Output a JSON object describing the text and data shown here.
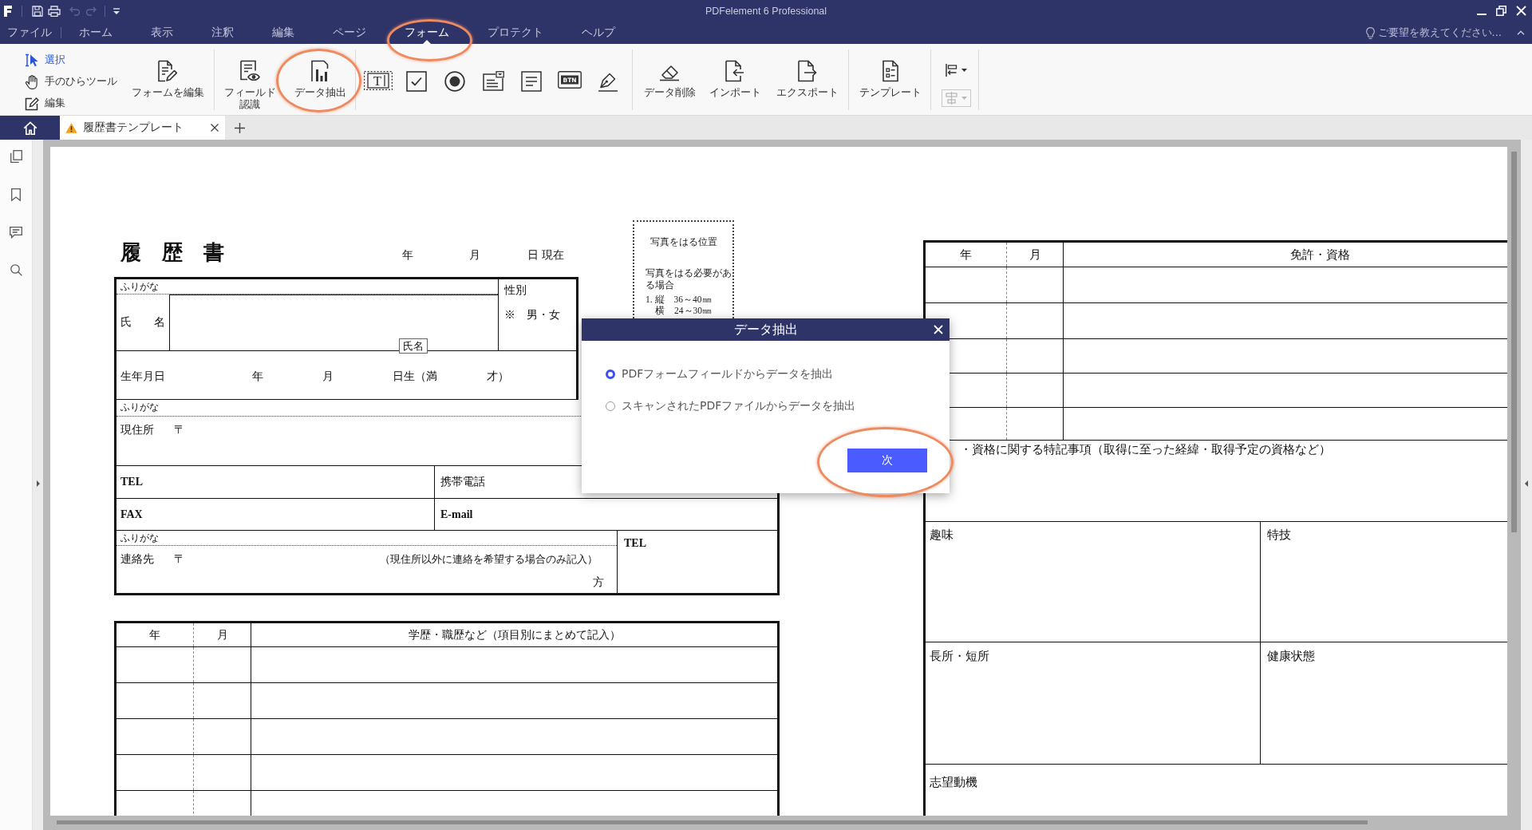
{
  "window": {
    "title": "PDFelement 6 Professional"
  },
  "quick_access": [
    {
      "kind": "save",
      "disabled": false
    },
    {
      "kind": "print",
      "disabled": false
    },
    {
      "kind": "undo",
      "disabled": true
    },
    {
      "kind": "redo",
      "disabled": true
    },
    {
      "kind": "customize",
      "disabled": false
    }
  ],
  "menu": [
    {
      "label": "ファイル",
      "selected": false,
      "highlighted": false
    },
    {
      "label": "ホーム",
      "selected": false,
      "highlighted": false
    },
    {
      "label": "表示",
      "selected": false,
      "highlighted": false
    },
    {
      "label": "注釈",
      "selected": false,
      "highlighted": false
    },
    {
      "label": "編集",
      "selected": false,
      "highlighted": false
    },
    {
      "label": "ページ",
      "selected": false,
      "highlighted": false
    },
    {
      "label": "フォーム",
      "selected": true,
      "highlighted": true
    },
    {
      "label": "プロテクト",
      "selected": false,
      "highlighted": false
    },
    {
      "label": "ヘルプ",
      "selected": false,
      "highlighted": false
    }
  ],
  "help_prompt": "ご要望を教えてください...",
  "tools": [
    {
      "kind": "select",
      "label": "選択",
      "selected": true
    },
    {
      "kind": "hand",
      "label": "手のひらツール",
      "selected": false
    },
    {
      "kind": "edit",
      "label": "編集",
      "selected": false
    }
  ],
  "ribbon": [
    {
      "items": [
        {
          "kind": "edit_form",
          "label": "フォームを編集",
          "highlighted": false,
          "disabled": false
        }
      ]
    },
    {
      "items": [
        {
          "kind": "field_recognition",
          "label": "フィールド認識",
          "highlighted": false,
          "disabled": false
        },
        {
          "kind": "data_extract",
          "label": "データ抽出",
          "highlighted": true,
          "disabled": false
        }
      ]
    },
    {
      "items": [
        {
          "kind": "text_field",
          "glyph": "T",
          "highlighted": false,
          "disabled": false
        },
        {
          "kind": "checkbox",
          "highlighted": false,
          "disabled": false
        },
        {
          "kind": "radio_button",
          "highlighted": false,
          "disabled": false
        },
        {
          "kind": "combo_box",
          "highlighted": false,
          "disabled": false
        },
        {
          "kind": "list_box",
          "highlighted": false,
          "disabled": false
        },
        {
          "kind": "button_field",
          "glyph": "BTN",
          "highlighted": false,
          "disabled": false
        },
        {
          "kind": "signature",
          "highlighted": false,
          "disabled": false
        }
      ]
    },
    {
      "items": [
        {
          "kind": "data_delete",
          "label": "データ削除",
          "highlighted": false,
          "disabled": false
        },
        {
          "kind": "import",
          "label": "インポート",
          "highlighted": false,
          "disabled": false
        },
        {
          "kind": "export",
          "label": "エクスポート",
          "highlighted": false,
          "disabled": false
        }
      ]
    },
    {
      "items": [
        {
          "kind": "template",
          "label": "テンプレート",
          "highlighted": false,
          "disabled": false
        }
      ]
    },
    {
      "items": [
        {
          "kind": "align",
          "highlighted": false,
          "disabled": false
        },
        {
          "kind": "distribute",
          "highlighted": false,
          "disabled": true
        }
      ]
    }
  ],
  "document_tabs": [
    {
      "label": "履歴書テンプレート",
      "selected": true,
      "warning": true
    }
  ],
  "resume": {
    "title": "履　歴　書",
    "date_labels": [
      "年",
      "月",
      "日 現在"
    ],
    "name": {
      "furigana": "ふりがな",
      "label": "氏　　名",
      "field_tag": "氏名"
    },
    "gender": {
      "label": "性別",
      "options": "※　男・女"
    },
    "birth_date": {
      "label": "生年月日",
      "parts": [
        "年",
        "月",
        "日生（満",
        "才）"
      ]
    },
    "address": {
      "furigana": "ふりがな",
      "label": "現住所",
      "postal_mark": "〒"
    },
    "phone": {
      "home": "TEL",
      "mobile": "携帯電話"
    },
    "fax": {
      "fax": "FAX",
      "email": "E-mail"
    },
    "contact": {
      "furigana": "ふりがな",
      "label": "連絡先",
      "postal_mark": "〒",
      "note": "（現住所以外に連絡を希望する場合のみ記入）",
      "suffix": "方",
      "tel": "TEL"
    },
    "photo": {
      "title": "写真をはる位置",
      "note": "写真をはる必要がある場合",
      "sizes": [
        "1. 縦　36～40㎜",
        "横　24～30㎜"
      ]
    },
    "education": {
      "columns": [
        "年",
        "月",
        "学歴・職歴など（項目別にまとめて記入）"
      ]
    },
    "licenses": {
      "columns": [
        "年",
        "月",
        "免許・資格"
      ]
    },
    "license_notes": "・資格に関する特記事項（取得に至った経緯・取得予定の資格など）",
    "hobbies": "趣味",
    "skills": "特技",
    "strengths": "長所・短所",
    "health": "健康状態",
    "motivation": "志望動機"
  },
  "dialog": {
    "title": "データ抽出",
    "options": [
      {
        "label": "PDFフォームフィールドからデータを抽出",
        "selected": true
      },
      {
        "label": "スキャンされたPDFファイルからデータを抽出",
        "selected": false
      }
    ],
    "next_button": {
      "label": "次",
      "highlighted": true
    }
  }
}
